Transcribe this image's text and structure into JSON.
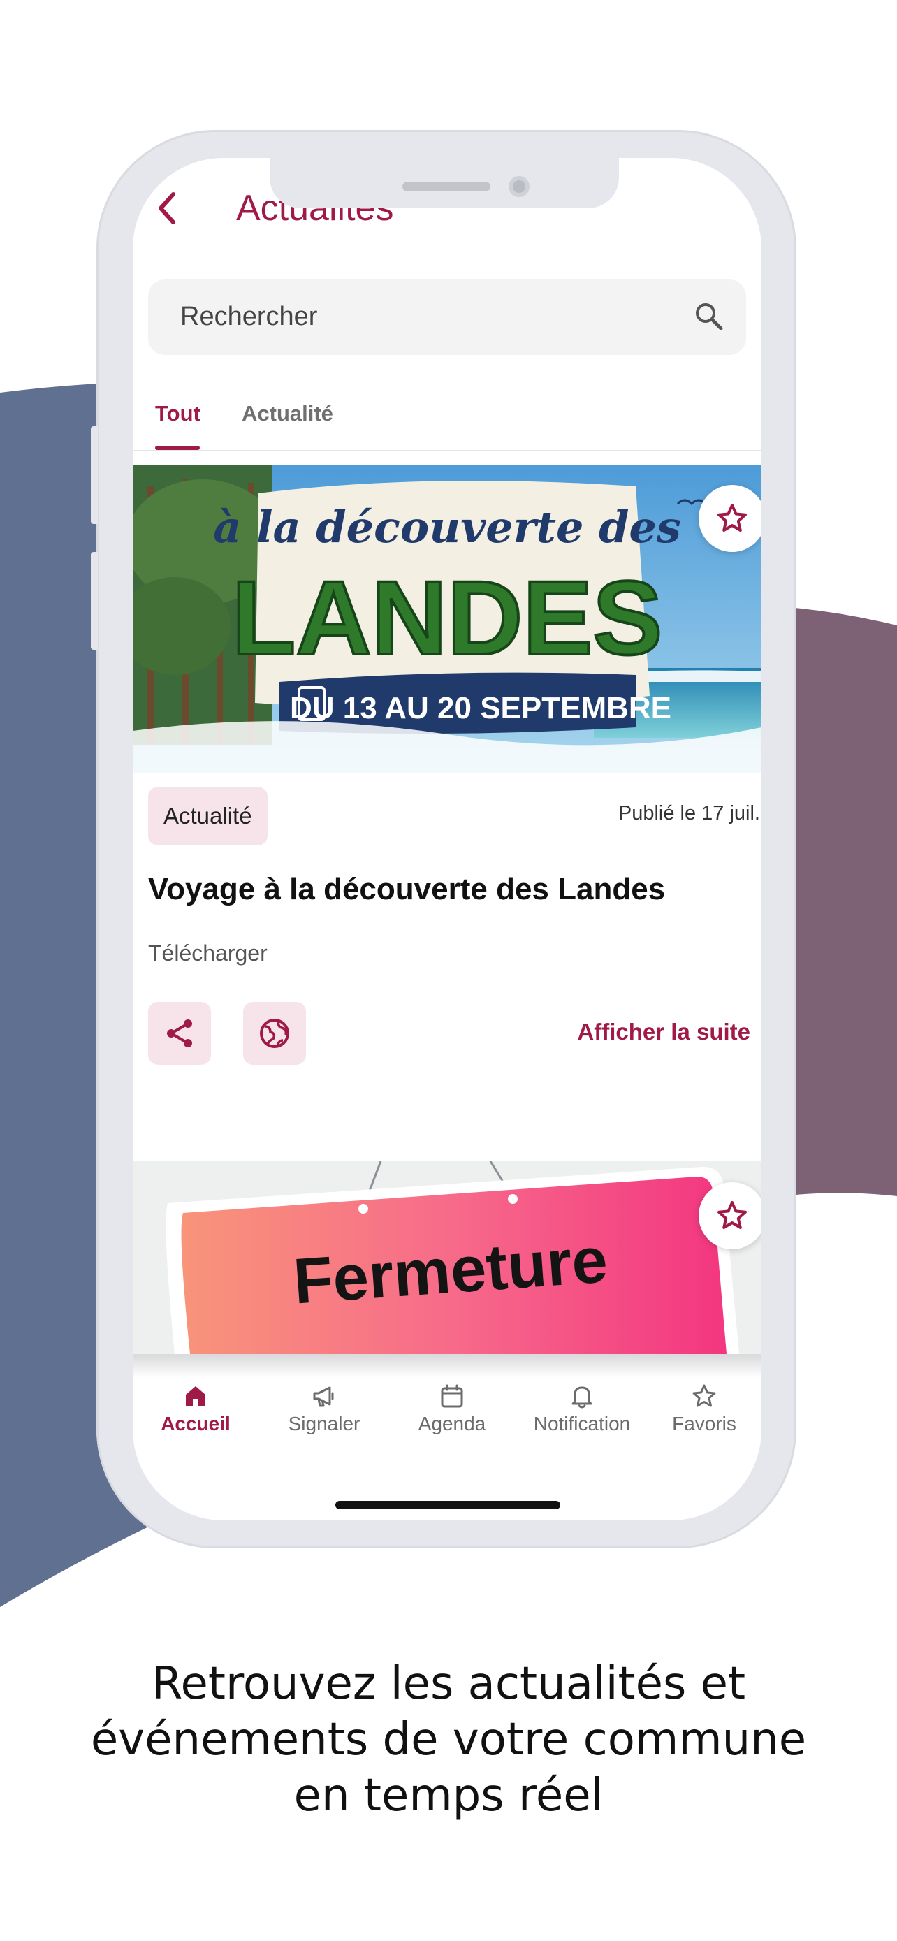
{
  "header": {
    "title": "Actualites"
  },
  "search": {
    "placeholder": "Rechercher"
  },
  "tabs": [
    {
      "label": "Tout",
      "active": true
    },
    {
      "label": "Actualité",
      "active": false
    }
  ],
  "cards": [
    {
      "image_text": {
        "line1": "à la découverte des",
        "line2": "LANDES",
        "line3": "DU 13 AU 20 SEPTEMBRE"
      },
      "category": "Actualité",
      "published": "Publié le 17 juil.",
      "title": "Voyage à la découverte des Landes",
      "download_label": "Télécharger",
      "more_label": "Afficher la suite"
    },
    {
      "image_text": {
        "line1": "Fermeture"
      }
    }
  ],
  "bottom_nav": [
    {
      "label": "Accueil",
      "icon": "home-icon",
      "active": true
    },
    {
      "label": "Signaler",
      "icon": "megaphone-icon",
      "active": false
    },
    {
      "label": "Agenda",
      "icon": "calendar-icon",
      "active": false
    },
    {
      "label": "Notification",
      "icon": "bell-icon",
      "active": false
    },
    {
      "label": "Favoris",
      "icon": "star-icon",
      "active": false
    }
  ],
  "caption": {
    "line1": "Retrouvez les actualités et",
    "line2": "événements de votre commune",
    "line3": "en temps réel"
  },
  "colors": {
    "accent": "#a01a48",
    "badge_bg": "#f6e4ea",
    "bg_left_shape": "#5f7090",
    "bg_right_shape": "#7d6276"
  }
}
